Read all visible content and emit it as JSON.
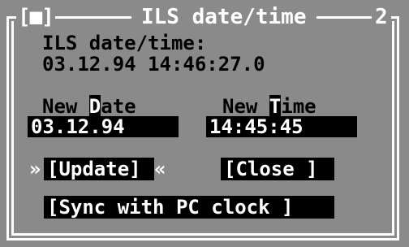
{
  "window": {
    "close_glyph": "[■]",
    "title": "ILS date/time",
    "number": "2"
  },
  "info": {
    "label": "ILS date/time:",
    "current_value": "03.12.94 14:46:27.0"
  },
  "new_date": {
    "label_prefix": "New ",
    "label_hotkey": "D",
    "label_suffix": "ate",
    "value": "03.12.94"
  },
  "new_time": {
    "label_prefix": "New ",
    "label_hotkey": "T",
    "label_suffix": "ime",
    "value": "14:45:45"
  },
  "buttons": {
    "update_left_marker": "»",
    "update_label": "[Update]",
    "update_right_marker": "«",
    "close_label": "[Close ]",
    "sync_label": "[Sync with PC clock ]"
  }
}
